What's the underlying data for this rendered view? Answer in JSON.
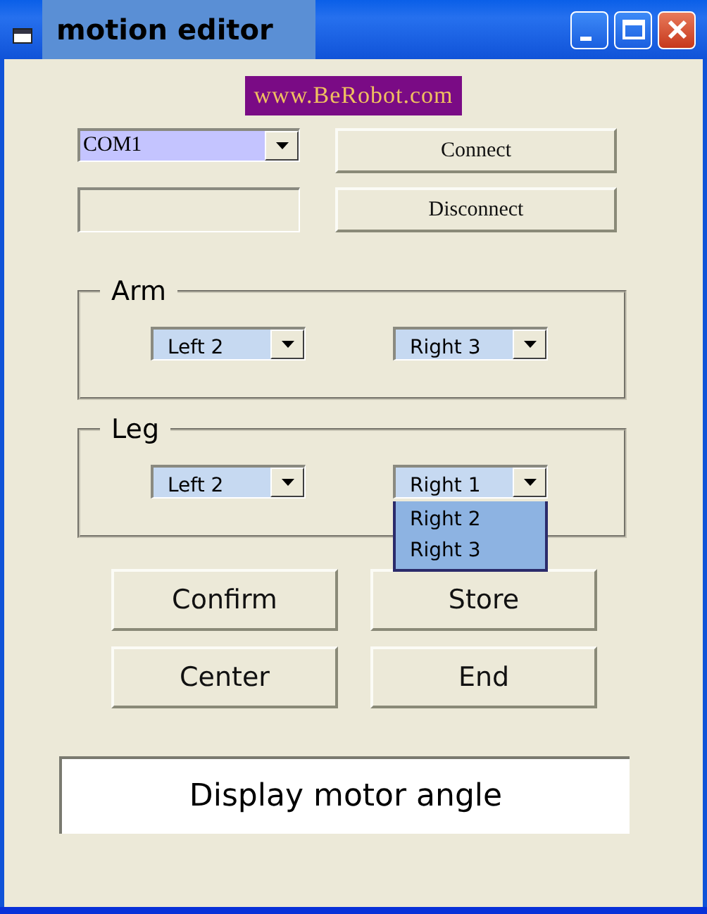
{
  "window": {
    "title": "motion editor"
  },
  "banner": "www.BeRobot.com",
  "port": {
    "value": "COM1"
  },
  "connection_buttons": [
    "Connect",
    "Disconnect"
  ],
  "groups": [
    {
      "label": "Arm",
      "combos": [
        {
          "value": "Left 2",
          "open": false
        },
        {
          "value": "Right 3",
          "open": false
        }
      ]
    },
    {
      "label": "Leg",
      "combos": [
        {
          "value": "Left 2",
          "open": false
        },
        {
          "value": "Right 1",
          "open": true,
          "options": [
            "Right 2",
            "Right 3"
          ]
        }
      ]
    }
  ],
  "buttons": [
    "Confirm",
    "Store",
    "Center",
    "End"
  ],
  "display": "Display motor angle"
}
